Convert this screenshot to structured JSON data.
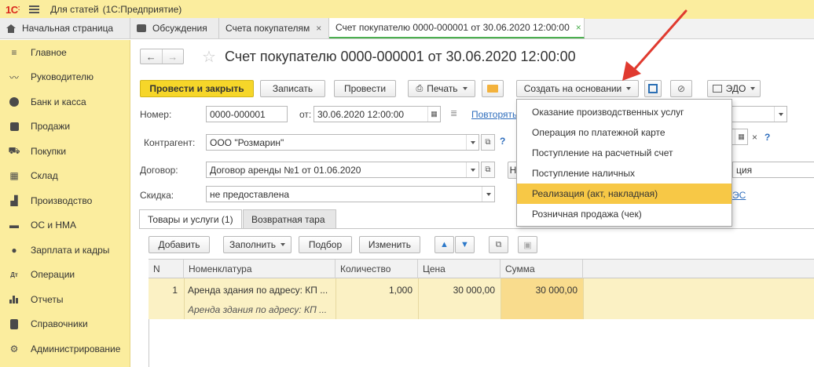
{
  "app": {
    "logo": "1С",
    "window_title": "Для статей",
    "window_subtitle": "(1С:Предприятие)"
  },
  "tabs": [
    {
      "label": "Начальная страница",
      "close": ""
    },
    {
      "label": "Обсуждения",
      "close": ""
    },
    {
      "label": "Счета покупателям",
      "close": "×"
    },
    {
      "label": "Счет покупателю 0000-000001 от 30.06.2020 12:00:00",
      "close": "×"
    }
  ],
  "sidebar": {
    "items": [
      {
        "label": "Главное",
        "icon": "menu-icon"
      },
      {
        "label": "Руководителю",
        "icon": "trend-icon"
      },
      {
        "label": "Банк и касса",
        "icon": "coin-icon"
      },
      {
        "label": "Продажи",
        "icon": "bag-icon"
      },
      {
        "label": "Покупки",
        "icon": "cart-icon"
      },
      {
        "label": "Склад",
        "icon": "warehouse-icon"
      },
      {
        "label": "Производство",
        "icon": "factory-icon"
      },
      {
        "label": "ОС и НМА",
        "icon": "truck-icon"
      },
      {
        "label": "Зарплата и кадры",
        "icon": "person-icon"
      },
      {
        "label": "Операции",
        "icon": "dt-kt-icon"
      },
      {
        "label": "Отчеты",
        "icon": "bar-chart-icon"
      },
      {
        "label": "Справочники",
        "icon": "book-icon"
      },
      {
        "label": "Администрирование",
        "icon": "gear-icon"
      }
    ]
  },
  "doc": {
    "title": "Счет покупателю 0000-000001 от 30.06.2020 12:00:00",
    "nav_back": "←",
    "nav_fwd": "→",
    "star": "☆"
  },
  "toolbar": {
    "post_close": "Провести и закрыть",
    "save": "Записать",
    "post": "Провести",
    "print": "Печать",
    "create_basis": "Создать на основании",
    "edo": "ЭДО"
  },
  "form": {
    "number_label": "Номер:",
    "number_value": "0000-000001",
    "from_label": "от:",
    "date_value": "30.06.2020 12:00:00",
    "repeat_link": "Повторять",
    "counterparty_label": "Контрагент:",
    "counterparty_value": "ООО \"Розмарин\"",
    "contract_label": "Договор:",
    "contract_value": "Договор аренды №1 от 01.06.2020",
    "contract_btn": "Н",
    "contract_right_value": "ция",
    "discount_label": "Скидка:",
    "discount_value": "не предоставлена",
    "right_link": "ЭС",
    "help": "?",
    "clear": "×"
  },
  "inner_tabs": {
    "goods": "Товары и услуги (1)",
    "returnable": "Возвратная тара"
  },
  "table_toolbar": {
    "add": "Добавить",
    "fill": "Заполнить",
    "pick": "Подбор",
    "change": "Изменить"
  },
  "table": {
    "headers": [
      "N",
      "Номенклатура",
      "Количество",
      "Цена",
      "Сумма"
    ],
    "rows": [
      {
        "n": "1",
        "item": "Аренда здания по адресу: КП ...",
        "item_sub": "Аренда здания по адресу: КП ...",
        "qty": "1,000",
        "price": "30 000,00",
        "sum": "30 000,00"
      }
    ]
  },
  "menu": {
    "items": [
      "Оказание производственных услуг",
      "Операция по платежной карте",
      "Поступление на расчетный счет",
      "Поступление наличных",
      "Реализация (акт, накладная)",
      "Розничная продажа (чек)"
    ],
    "highlighted_index": 4,
    "highlight_color": "#f7c846"
  },
  "colors": {
    "panel_yellow": "#fbed9e",
    "primary_button": "#f6d629",
    "annotation_arrow": "#e03a2f",
    "link": "#2f6ebd"
  }
}
